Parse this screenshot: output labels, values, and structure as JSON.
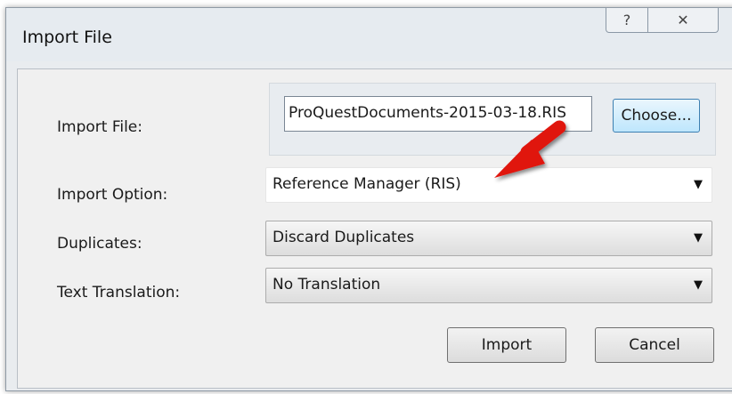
{
  "window": {
    "title": "Import File",
    "help_glyph": "?",
    "close_glyph": "✕"
  },
  "labels": {
    "import_file": "Import File:",
    "import_option": "Import Option:",
    "duplicates": "Duplicates:",
    "text_translation": "Text Translation:"
  },
  "import_file": {
    "value": "ProQuestDocuments-2015-03-18.RIS",
    "choose_label": "Choose..."
  },
  "import_option": {
    "selected": "Reference Manager (RIS)"
  },
  "duplicates": {
    "selected": "Discard Duplicates"
  },
  "text_translation": {
    "selected": "No Translation"
  },
  "buttons": {
    "import_label": "Import",
    "cancel_label": "Cancel"
  },
  "dropdown_glyph": "▼",
  "annotation": {
    "arrow_color": "#e0130f"
  }
}
